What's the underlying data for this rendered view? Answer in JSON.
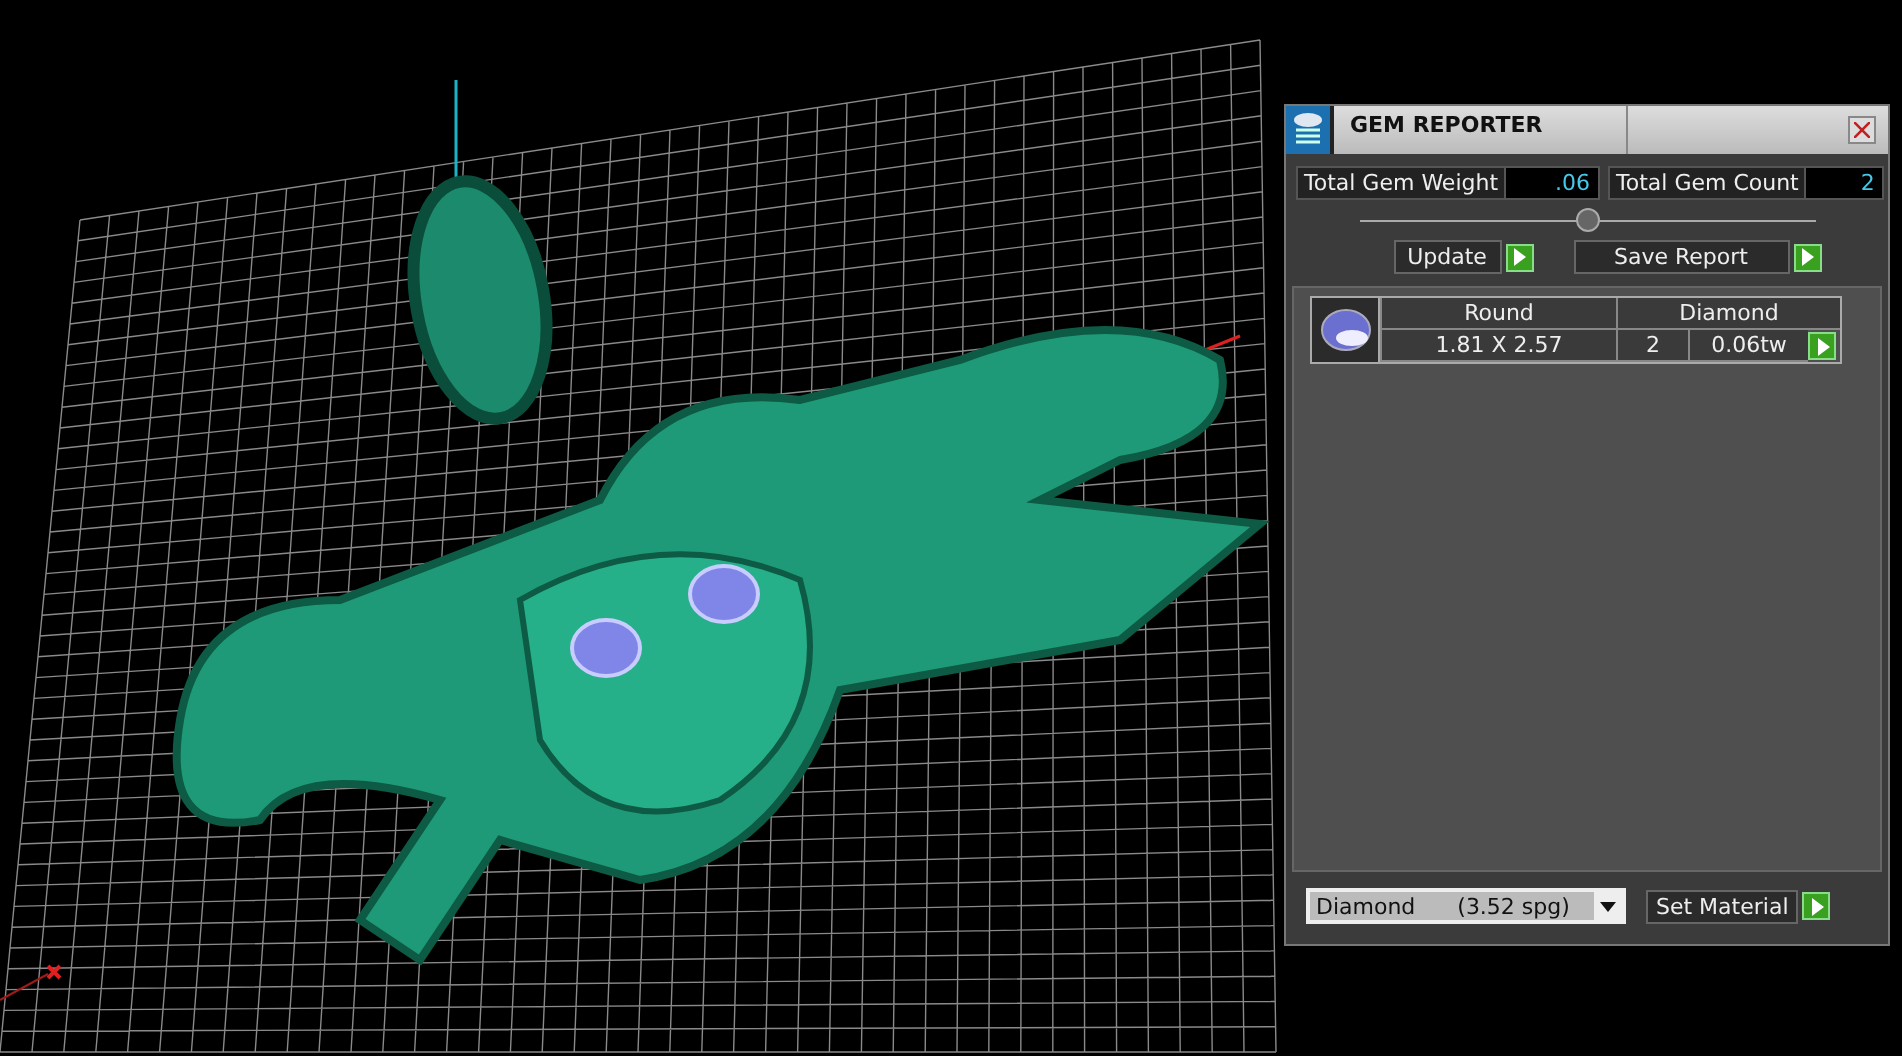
{
  "window": {
    "title": "GEM REPORTER"
  },
  "totals": [
    {
      "label": "Total Gem Weight",
      "value": ".06"
    },
    {
      "label": "Total Gem Count",
      "value": "2"
    }
  ],
  "buttons": [
    {
      "label": "Update"
    },
    {
      "label": "Save Report"
    }
  ],
  "gems": [
    {
      "shape": "Round",
      "material": "Diamond",
      "size": "1.81 X 2.57",
      "count": "2",
      "weight": "0.06tw"
    }
  ],
  "material_select": {
    "value": "Diamond      (3.52 spg)"
  },
  "set_button": {
    "label": "Set Material"
  }
}
